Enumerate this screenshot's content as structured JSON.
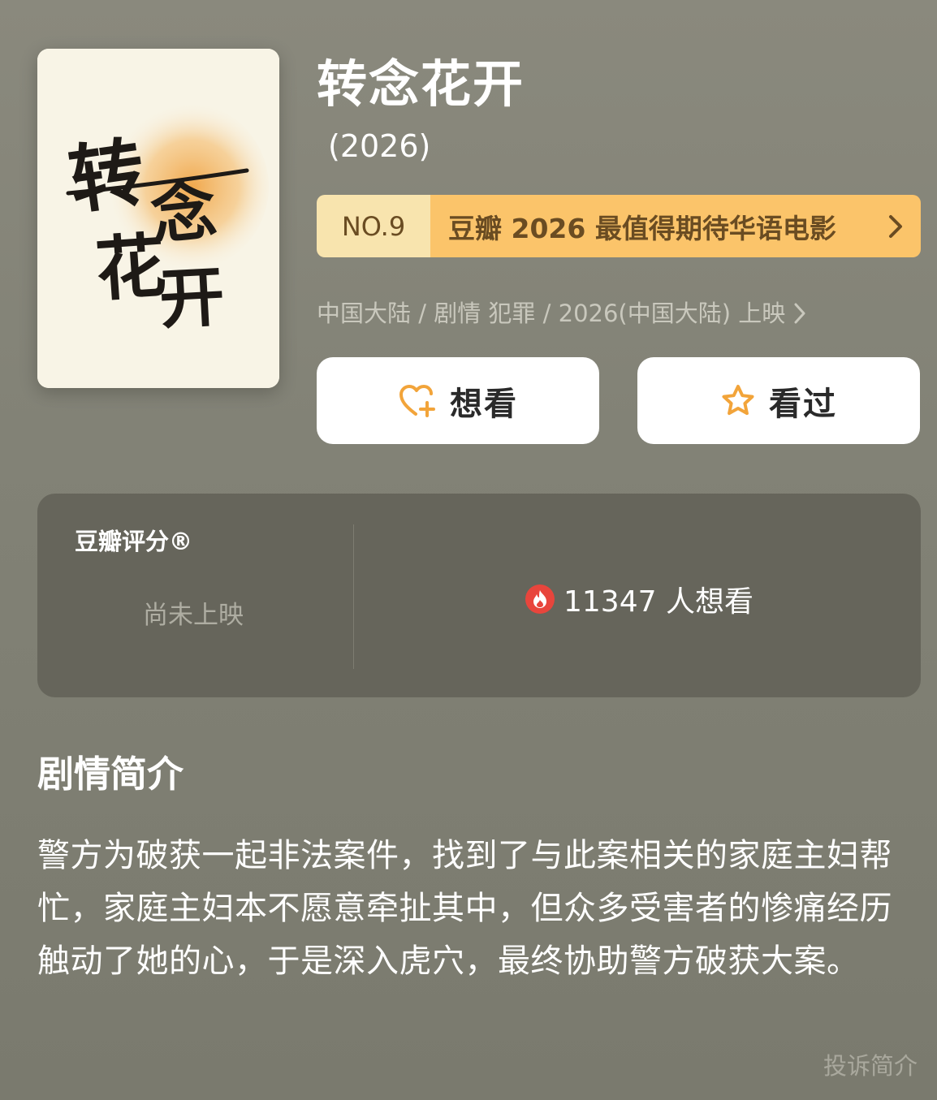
{
  "poster": {
    "calligraphy_chars": [
      "转",
      "念",
      "花",
      "开"
    ]
  },
  "movie": {
    "title": "转念花开",
    "year": "(2026)"
  },
  "ranking": {
    "number": "NO.9",
    "label": "豆瓣 2026 最值得期待华语电影"
  },
  "meta": {
    "info": "中国大陆 / 剧情 犯罪 / 2026(中国大陆) 上映"
  },
  "actions": {
    "want_label": "想看",
    "seen_label": "看过"
  },
  "rating": {
    "title": "豆瓣评分®",
    "status": "尚未上映",
    "want_count_text": "11347 人想看"
  },
  "synopsis": {
    "heading": "剧情简介",
    "body": "警方为破获一起非法案件，找到了与此案相关的家庭主妇帮忙，家庭主妇本不愿意牵扯其中，但众多受害者的惨痛经历触动了她的心，于是深入虎穴，最终协助警方破获大案。",
    "report_label": "投诉简介"
  },
  "colors": {
    "background": "#84837a",
    "rank_no_bg": "#f8e4ae",
    "rank_text_bg": "#fbc46a",
    "accent_orange": "#f2a43a",
    "hot_red": "#e8453c",
    "panel_bg": "#66655b"
  },
  "icons": {
    "want": "heart-plus-icon",
    "seen": "star-outline-icon",
    "hot": "flame-icon",
    "chevron": "chevron-right-icon"
  }
}
